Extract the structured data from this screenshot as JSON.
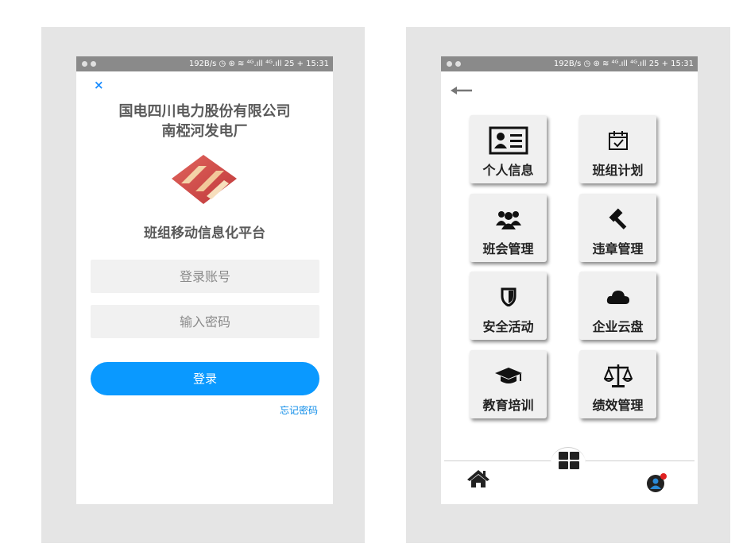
{
  "status_bar": {
    "right_text": "192B/s ◷ ⊛ ≋ ⁴ᴳ.ıll ⁴ᴳ.ıll 25 + 15:31"
  },
  "login": {
    "close_label": "×",
    "company_line1": "国电四川电力股份有限公司",
    "company_line2": "南椏河发电厂",
    "platform_title": "班组移动信息化平台",
    "account_placeholder": "登录账号",
    "password_placeholder": "输入密码",
    "login_label": "登录",
    "forgot_label": "忘记密码",
    "brand_color": "#d9534f",
    "accent_color": "#0a99ff"
  },
  "menu": {
    "tiles": [
      {
        "label": "个人信息",
        "icon": "id-card-icon"
      },
      {
        "label": "班组计划",
        "icon": "calendar-check-icon"
      },
      {
        "label": "班会管理",
        "icon": "users-icon"
      },
      {
        "label": "违章管理",
        "icon": "gavel-icon"
      },
      {
        "label": "安全活动",
        "icon": "shield-icon"
      },
      {
        "label": "企业云盘",
        "icon": "cloud-icon"
      },
      {
        "label": "教育培训",
        "icon": "graduation-cap-icon"
      },
      {
        "label": "绩效管理",
        "icon": "balance-scale-icon"
      }
    ],
    "bottom_nav": {
      "home": "home-icon",
      "center": "grid-icon",
      "profile": "user-avatar-icon"
    }
  }
}
